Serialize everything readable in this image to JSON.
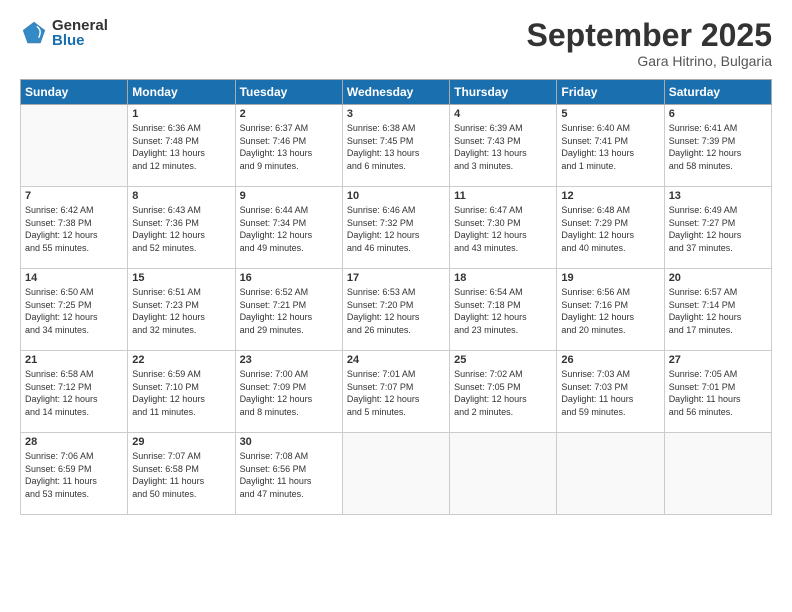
{
  "header": {
    "logo_general": "General",
    "logo_blue": "Blue",
    "month_title": "September 2025",
    "location": "Gara Hitrino, Bulgaria"
  },
  "days_of_week": [
    "Sunday",
    "Monday",
    "Tuesday",
    "Wednesday",
    "Thursday",
    "Friday",
    "Saturday"
  ],
  "weeks": [
    [
      {
        "day": "",
        "info": ""
      },
      {
        "day": "1",
        "info": "Sunrise: 6:36 AM\nSunset: 7:48 PM\nDaylight: 13 hours\nand 12 minutes."
      },
      {
        "day": "2",
        "info": "Sunrise: 6:37 AM\nSunset: 7:46 PM\nDaylight: 13 hours\nand 9 minutes."
      },
      {
        "day": "3",
        "info": "Sunrise: 6:38 AM\nSunset: 7:45 PM\nDaylight: 13 hours\nand 6 minutes."
      },
      {
        "day": "4",
        "info": "Sunrise: 6:39 AM\nSunset: 7:43 PM\nDaylight: 13 hours\nand 3 minutes."
      },
      {
        "day": "5",
        "info": "Sunrise: 6:40 AM\nSunset: 7:41 PM\nDaylight: 13 hours\nand 1 minute."
      },
      {
        "day": "6",
        "info": "Sunrise: 6:41 AM\nSunset: 7:39 PM\nDaylight: 12 hours\nand 58 minutes."
      }
    ],
    [
      {
        "day": "7",
        "info": "Sunrise: 6:42 AM\nSunset: 7:38 PM\nDaylight: 12 hours\nand 55 minutes."
      },
      {
        "day": "8",
        "info": "Sunrise: 6:43 AM\nSunset: 7:36 PM\nDaylight: 12 hours\nand 52 minutes."
      },
      {
        "day": "9",
        "info": "Sunrise: 6:44 AM\nSunset: 7:34 PM\nDaylight: 12 hours\nand 49 minutes."
      },
      {
        "day": "10",
        "info": "Sunrise: 6:46 AM\nSunset: 7:32 PM\nDaylight: 12 hours\nand 46 minutes."
      },
      {
        "day": "11",
        "info": "Sunrise: 6:47 AM\nSunset: 7:30 PM\nDaylight: 12 hours\nand 43 minutes."
      },
      {
        "day": "12",
        "info": "Sunrise: 6:48 AM\nSunset: 7:29 PM\nDaylight: 12 hours\nand 40 minutes."
      },
      {
        "day": "13",
        "info": "Sunrise: 6:49 AM\nSunset: 7:27 PM\nDaylight: 12 hours\nand 37 minutes."
      }
    ],
    [
      {
        "day": "14",
        "info": "Sunrise: 6:50 AM\nSunset: 7:25 PM\nDaylight: 12 hours\nand 34 minutes."
      },
      {
        "day": "15",
        "info": "Sunrise: 6:51 AM\nSunset: 7:23 PM\nDaylight: 12 hours\nand 32 minutes."
      },
      {
        "day": "16",
        "info": "Sunrise: 6:52 AM\nSunset: 7:21 PM\nDaylight: 12 hours\nand 29 minutes."
      },
      {
        "day": "17",
        "info": "Sunrise: 6:53 AM\nSunset: 7:20 PM\nDaylight: 12 hours\nand 26 minutes."
      },
      {
        "day": "18",
        "info": "Sunrise: 6:54 AM\nSunset: 7:18 PM\nDaylight: 12 hours\nand 23 minutes."
      },
      {
        "day": "19",
        "info": "Sunrise: 6:56 AM\nSunset: 7:16 PM\nDaylight: 12 hours\nand 20 minutes."
      },
      {
        "day": "20",
        "info": "Sunrise: 6:57 AM\nSunset: 7:14 PM\nDaylight: 12 hours\nand 17 minutes."
      }
    ],
    [
      {
        "day": "21",
        "info": "Sunrise: 6:58 AM\nSunset: 7:12 PM\nDaylight: 12 hours\nand 14 minutes."
      },
      {
        "day": "22",
        "info": "Sunrise: 6:59 AM\nSunset: 7:10 PM\nDaylight: 12 hours\nand 11 minutes."
      },
      {
        "day": "23",
        "info": "Sunrise: 7:00 AM\nSunset: 7:09 PM\nDaylight: 12 hours\nand 8 minutes."
      },
      {
        "day": "24",
        "info": "Sunrise: 7:01 AM\nSunset: 7:07 PM\nDaylight: 12 hours\nand 5 minutes."
      },
      {
        "day": "25",
        "info": "Sunrise: 7:02 AM\nSunset: 7:05 PM\nDaylight: 12 hours\nand 2 minutes."
      },
      {
        "day": "26",
        "info": "Sunrise: 7:03 AM\nSunset: 7:03 PM\nDaylight: 11 hours\nand 59 minutes."
      },
      {
        "day": "27",
        "info": "Sunrise: 7:05 AM\nSunset: 7:01 PM\nDaylight: 11 hours\nand 56 minutes."
      }
    ],
    [
      {
        "day": "28",
        "info": "Sunrise: 7:06 AM\nSunset: 6:59 PM\nDaylight: 11 hours\nand 53 minutes."
      },
      {
        "day": "29",
        "info": "Sunrise: 7:07 AM\nSunset: 6:58 PM\nDaylight: 11 hours\nand 50 minutes."
      },
      {
        "day": "30",
        "info": "Sunrise: 7:08 AM\nSunset: 6:56 PM\nDaylight: 11 hours\nand 47 minutes."
      },
      {
        "day": "",
        "info": ""
      },
      {
        "day": "",
        "info": ""
      },
      {
        "day": "",
        "info": ""
      },
      {
        "day": "",
        "info": ""
      }
    ]
  ]
}
